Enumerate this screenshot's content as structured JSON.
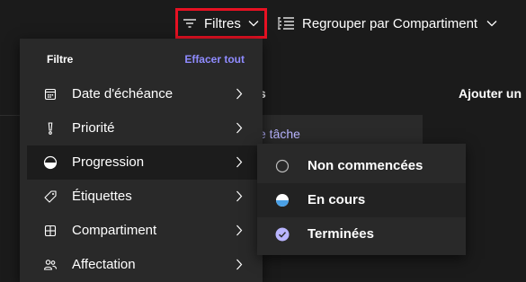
{
  "toolbar": {
    "filters_label": "Filtres",
    "group_label": "Regrouper par Compartiment"
  },
  "board": {
    "bucket_title_fragment": "s",
    "add_bucket_label": "Ajouter un",
    "add_task_fragment": "e tâche"
  },
  "filter_menu": {
    "title": "Filtre",
    "clear_label": "Effacer tout",
    "items": [
      {
        "label": "Date d'échéance",
        "icon": "calendar-icon"
      },
      {
        "label": "Priorité",
        "icon": "priority-icon"
      },
      {
        "label": "Progression",
        "icon": "progress-icon",
        "active": true
      },
      {
        "label": "Étiquettes",
        "icon": "tag-icon"
      },
      {
        "label": "Compartiment",
        "icon": "bucket-icon"
      },
      {
        "label": "Affectation",
        "icon": "people-icon"
      }
    ]
  },
  "progress_submenu": {
    "items": [
      {
        "label": "Non commencées",
        "icon": "not-started-icon"
      },
      {
        "label": "En cours",
        "icon": "in-progress-icon"
      },
      {
        "label": "Terminées",
        "icon": "completed-icon"
      }
    ]
  },
  "colors": {
    "background": "#1b1b1b",
    "menu": "#292929",
    "accent": "#8f8bff",
    "highlight_border": "#e81123",
    "progress_fill": "#4aa0e6",
    "completed_fill": "#b9b5ff"
  }
}
